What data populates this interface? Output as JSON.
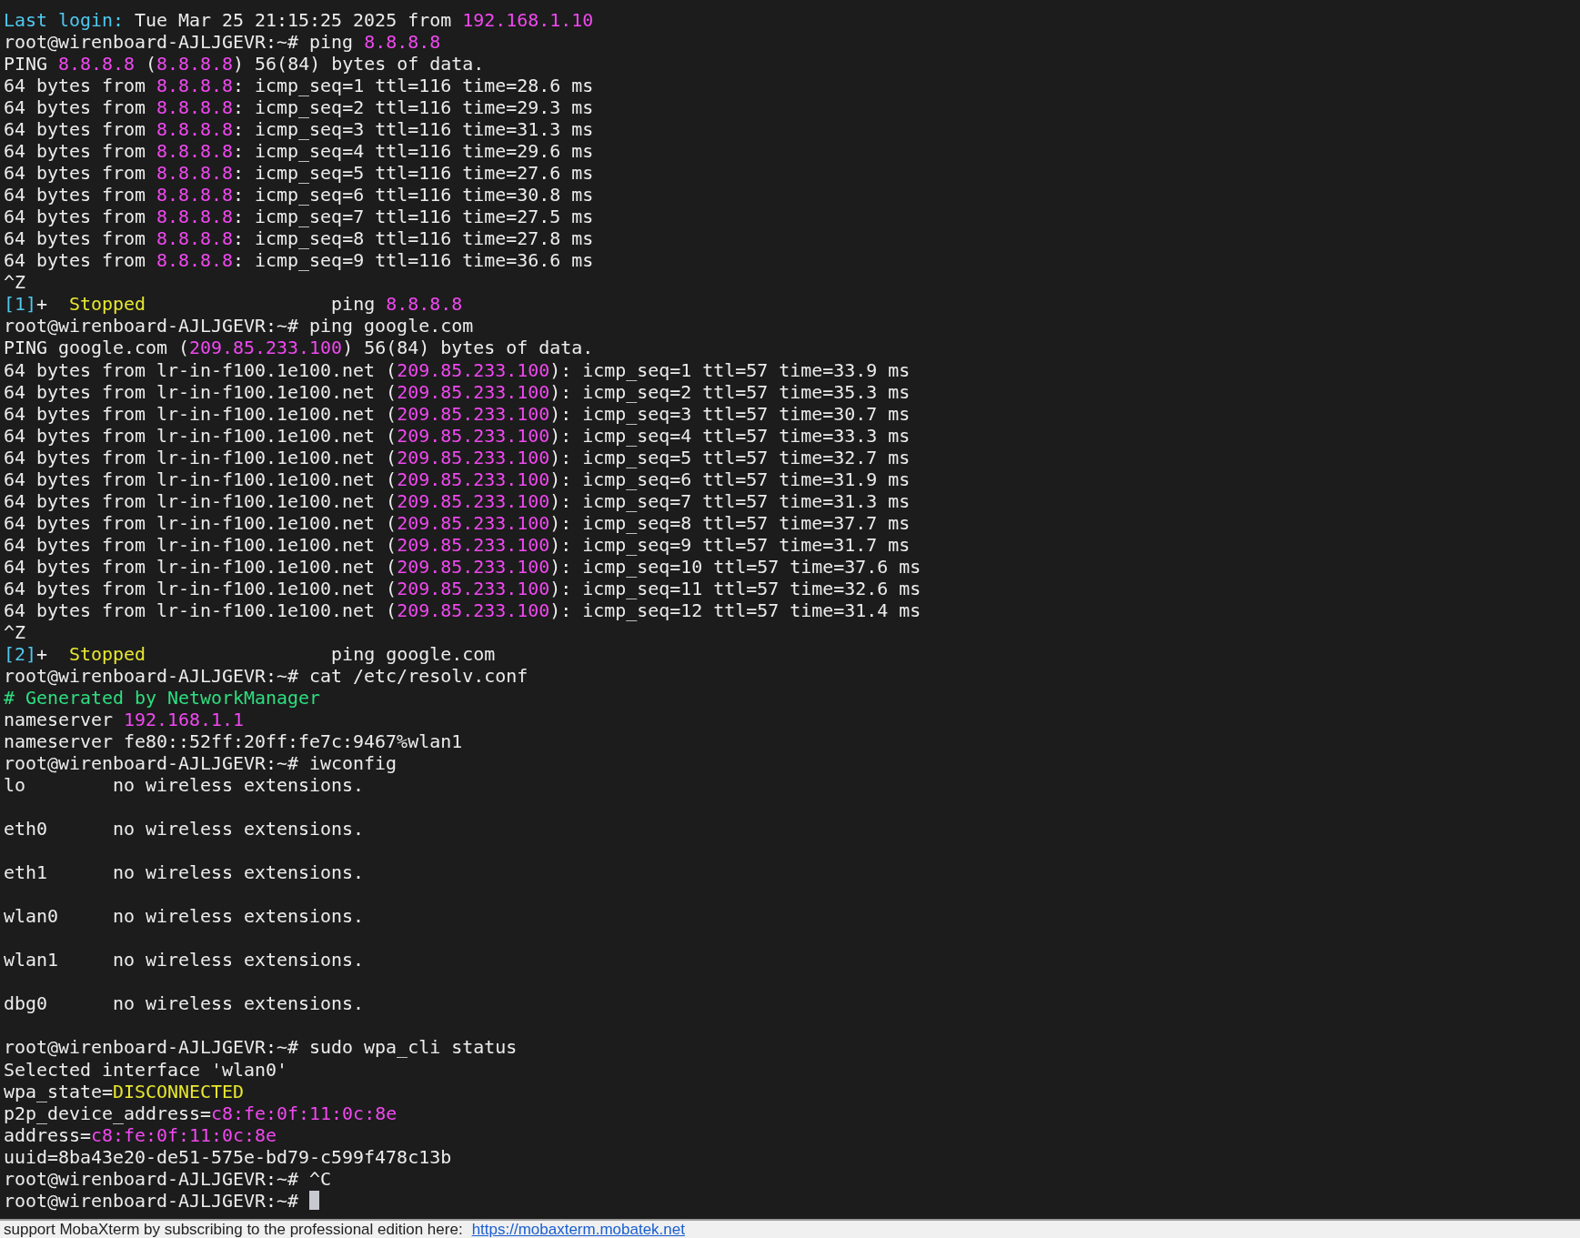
{
  "terminal": {
    "lines": [
      {
        "kind": "text",
        "segments": [
          {
            "text": "Last login:",
            "color": "#4fc8ef"
          },
          {
            "text": " Tue Mar 25 21:15:25 2025 from "
          },
          {
            "text": "192.168.1.10",
            "color": "#f048f0"
          }
        ]
      },
      {
        "kind": "text",
        "segments": [
          {
            "text": "root@wirenboard-AJLJGEVR:~# ping "
          },
          {
            "text": "8.8.8.8",
            "color": "#f048f0"
          }
        ]
      },
      {
        "kind": "text",
        "segments": [
          {
            "text": "PING "
          },
          {
            "text": "8.8.8.8",
            "color": "#f048f0"
          },
          {
            "text": " ("
          },
          {
            "text": "8.8.8.8",
            "color": "#f048f0"
          },
          {
            "text": ") 56(84) bytes of data."
          }
        ]
      },
      {
        "kind": "text",
        "segments": [
          {
            "text": "64 bytes from "
          },
          {
            "text": "8.8.8.8",
            "color": "#f048f0"
          },
          {
            "text": ": icmp_seq=1 ttl=116 time=28.6 ms"
          }
        ]
      },
      {
        "kind": "text",
        "segments": [
          {
            "text": "64 bytes from "
          },
          {
            "text": "8.8.8.8",
            "color": "#f048f0"
          },
          {
            "text": ": icmp_seq=2 ttl=116 time=29.3 ms"
          }
        ]
      },
      {
        "kind": "text",
        "segments": [
          {
            "text": "64 bytes from "
          },
          {
            "text": "8.8.8.8",
            "color": "#f048f0"
          },
          {
            "text": ": icmp_seq=3 ttl=116 time=31.3 ms"
          }
        ]
      },
      {
        "kind": "text",
        "segments": [
          {
            "text": "64 bytes from "
          },
          {
            "text": "8.8.8.8",
            "color": "#f048f0"
          },
          {
            "text": ": icmp_seq=4 ttl=116 time=29.6 ms"
          }
        ]
      },
      {
        "kind": "text",
        "segments": [
          {
            "text": "64 bytes from "
          },
          {
            "text": "8.8.8.8",
            "color": "#f048f0"
          },
          {
            "text": ": icmp_seq=5 ttl=116 time=27.6 ms"
          }
        ]
      },
      {
        "kind": "text",
        "segments": [
          {
            "text": "64 bytes from "
          },
          {
            "text": "8.8.8.8",
            "color": "#f048f0"
          },
          {
            "text": ": icmp_seq=6 ttl=116 time=30.8 ms"
          }
        ]
      },
      {
        "kind": "text",
        "segments": [
          {
            "text": "64 bytes from "
          },
          {
            "text": "8.8.8.8",
            "color": "#f048f0"
          },
          {
            "text": ": icmp_seq=7 ttl=116 time=27.5 ms"
          }
        ]
      },
      {
        "kind": "text",
        "segments": [
          {
            "text": "64 bytes from "
          },
          {
            "text": "8.8.8.8",
            "color": "#f048f0"
          },
          {
            "text": ": icmp_seq=8 ttl=116 time=27.8 ms"
          }
        ]
      },
      {
        "kind": "text",
        "segments": [
          {
            "text": "64 bytes from "
          },
          {
            "text": "8.8.8.8",
            "color": "#f048f0"
          },
          {
            "text": ": icmp_seq=9 ttl=116 time=36.6 ms"
          }
        ]
      },
      {
        "kind": "text",
        "segments": [
          {
            "text": "^Z"
          }
        ]
      },
      {
        "kind": "text",
        "segments": [
          {
            "text": "[1]",
            "color": "#4fc8ef"
          },
          {
            "text": "+  "
          },
          {
            "text": "Stopped",
            "color": "#e8e830"
          },
          {
            "text": "                 ping "
          },
          {
            "text": "8.8.8.8",
            "color": "#f048f0"
          }
        ]
      },
      {
        "kind": "text",
        "segments": [
          {
            "text": "root@wirenboard-AJLJGEVR:~# ping google.com"
          }
        ]
      },
      {
        "kind": "text",
        "segments": [
          {
            "text": "PING google.com ("
          },
          {
            "text": "209.85.233.100",
            "color": "#f048f0"
          },
          {
            "text": ") 56(84) bytes of data."
          }
        ]
      },
      {
        "kind": "text",
        "segments": [
          {
            "text": "64 bytes from lr-in-f100.1e100.net ("
          },
          {
            "text": "209.85.233.100",
            "color": "#f048f0"
          },
          {
            "text": "): icmp_seq=1 ttl=57 time=33.9 ms"
          }
        ]
      },
      {
        "kind": "text",
        "segments": [
          {
            "text": "64 bytes from lr-in-f100.1e100.net ("
          },
          {
            "text": "209.85.233.100",
            "color": "#f048f0"
          },
          {
            "text": "): icmp_seq=2 ttl=57 time=35.3 ms"
          }
        ]
      },
      {
        "kind": "text",
        "segments": [
          {
            "text": "64 bytes from lr-in-f100.1e100.net ("
          },
          {
            "text": "209.85.233.100",
            "color": "#f048f0"
          },
          {
            "text": "): icmp_seq=3 ttl=57 time=30.7 ms"
          }
        ]
      },
      {
        "kind": "text",
        "segments": [
          {
            "text": "64 bytes from lr-in-f100.1e100.net ("
          },
          {
            "text": "209.85.233.100",
            "color": "#f048f0"
          },
          {
            "text": "): icmp_seq=4 ttl=57 time=33.3 ms"
          }
        ]
      },
      {
        "kind": "text",
        "segments": [
          {
            "text": "64 bytes from lr-in-f100.1e100.net ("
          },
          {
            "text": "209.85.233.100",
            "color": "#f048f0"
          },
          {
            "text": "): icmp_seq=5 ttl=57 time=32.7 ms"
          }
        ]
      },
      {
        "kind": "text",
        "segments": [
          {
            "text": "64 bytes from lr-in-f100.1e100.net ("
          },
          {
            "text": "209.85.233.100",
            "color": "#f048f0"
          },
          {
            "text": "): icmp_seq=6 ttl=57 time=31.9 ms"
          }
        ]
      },
      {
        "kind": "text",
        "segments": [
          {
            "text": "64 bytes from lr-in-f100.1e100.net ("
          },
          {
            "text": "209.85.233.100",
            "color": "#f048f0"
          },
          {
            "text": "): icmp_seq=7 ttl=57 time=31.3 ms"
          }
        ]
      },
      {
        "kind": "text",
        "segments": [
          {
            "text": "64 bytes from lr-in-f100.1e100.net ("
          },
          {
            "text": "209.85.233.100",
            "color": "#f048f0"
          },
          {
            "text": "): icmp_seq=8 ttl=57 time=37.7 ms"
          }
        ]
      },
      {
        "kind": "text",
        "segments": [
          {
            "text": "64 bytes from lr-in-f100.1e100.net ("
          },
          {
            "text": "209.85.233.100",
            "color": "#f048f0"
          },
          {
            "text": "): icmp_seq=9 ttl=57 time=31.7 ms"
          }
        ]
      },
      {
        "kind": "text",
        "segments": [
          {
            "text": "64 bytes from lr-in-f100.1e100.net ("
          },
          {
            "text": "209.85.233.100",
            "color": "#f048f0"
          },
          {
            "text": "): icmp_seq=10 ttl=57 time=37.6 ms"
          }
        ]
      },
      {
        "kind": "text",
        "segments": [
          {
            "text": "64 bytes from lr-in-f100.1e100.net ("
          },
          {
            "text": "209.85.233.100",
            "color": "#f048f0"
          },
          {
            "text": "): icmp_seq=11 ttl=57 time=32.6 ms"
          }
        ]
      },
      {
        "kind": "text",
        "segments": [
          {
            "text": "64 bytes from lr-in-f100.1e100.net ("
          },
          {
            "text": "209.85.233.100",
            "color": "#f048f0"
          },
          {
            "text": "): icmp_seq=12 ttl=57 time=31.4 ms"
          }
        ]
      },
      {
        "kind": "text",
        "segments": [
          {
            "text": "^Z"
          }
        ]
      },
      {
        "kind": "text",
        "segments": [
          {
            "text": "[2]",
            "color": "#4fc8ef"
          },
          {
            "text": "+  "
          },
          {
            "text": "Stopped",
            "color": "#e8e830"
          },
          {
            "text": "                 ping google.com"
          }
        ]
      },
      {
        "kind": "text",
        "segments": [
          {
            "text": "root@wirenboard-AJLJGEVR:~# cat /etc/resolv.conf"
          }
        ]
      },
      {
        "kind": "text",
        "segments": [
          {
            "text": "# Generated by NetworkManager",
            "color": "#2edf80"
          }
        ]
      },
      {
        "kind": "text",
        "segments": [
          {
            "text": "nameserver "
          },
          {
            "text": "192.168.1.1",
            "color": "#f048f0"
          }
        ]
      },
      {
        "kind": "text",
        "segments": [
          {
            "text": "nameserver fe80::52ff:20ff:fe7c:9467%wlan1"
          }
        ]
      },
      {
        "kind": "text",
        "segments": [
          {
            "text": "root@wirenboard-AJLJGEVR:~# iwconfig"
          }
        ]
      },
      {
        "kind": "text",
        "segments": [
          {
            "text": "lo        no wireless extensions."
          }
        ]
      },
      {
        "kind": "blank"
      },
      {
        "kind": "text",
        "segments": [
          {
            "text": "eth0      no wireless extensions."
          }
        ]
      },
      {
        "kind": "blank"
      },
      {
        "kind": "text",
        "segments": [
          {
            "text": "eth1      no wireless extensions."
          }
        ]
      },
      {
        "kind": "blank"
      },
      {
        "kind": "text",
        "segments": [
          {
            "text": "wlan0     no wireless extensions."
          }
        ]
      },
      {
        "kind": "blank"
      },
      {
        "kind": "text",
        "segments": [
          {
            "text": "wlan1     no wireless extensions."
          }
        ]
      },
      {
        "kind": "blank"
      },
      {
        "kind": "text",
        "segments": [
          {
            "text": "dbg0      no wireless extensions."
          }
        ]
      },
      {
        "kind": "blank"
      },
      {
        "kind": "text",
        "segments": [
          {
            "text": "root@wirenboard-AJLJGEVR:~# sudo wpa_cli status"
          }
        ]
      },
      {
        "kind": "text",
        "segments": [
          {
            "text": "Selected interface 'wlan0'"
          }
        ]
      },
      {
        "kind": "text",
        "segments": [
          {
            "text": "wpa_state="
          },
          {
            "text": "DISCONNECTED",
            "color": "#e8e830"
          }
        ]
      },
      {
        "kind": "text",
        "segments": [
          {
            "text": "p2p_device_address="
          },
          {
            "text": "c8:fe:0f:11:0c:8e",
            "color": "#f048f0"
          }
        ]
      },
      {
        "kind": "text",
        "segments": [
          {
            "text": "address="
          },
          {
            "text": "c8:fe:0f:11:0c:8e",
            "color": "#f048f0"
          }
        ]
      },
      {
        "kind": "text",
        "segments": [
          {
            "text": "uuid=8ba43e20-de51-575e-bd79-c599f478c13b"
          }
        ]
      },
      {
        "kind": "text",
        "segments": [
          {
            "text": "root@wirenboard-AJLJGEVR:~# ^C"
          }
        ]
      },
      {
        "kind": "input",
        "segments": [
          {
            "text": "root@wirenboard-AJLJGEVR:~# "
          }
        ]
      }
    ]
  },
  "status_bar": {
    "text": "support MobaXterm by subscribing to the professional edition here:",
    "link": "https://mobaxterm.mobatek.net"
  }
}
